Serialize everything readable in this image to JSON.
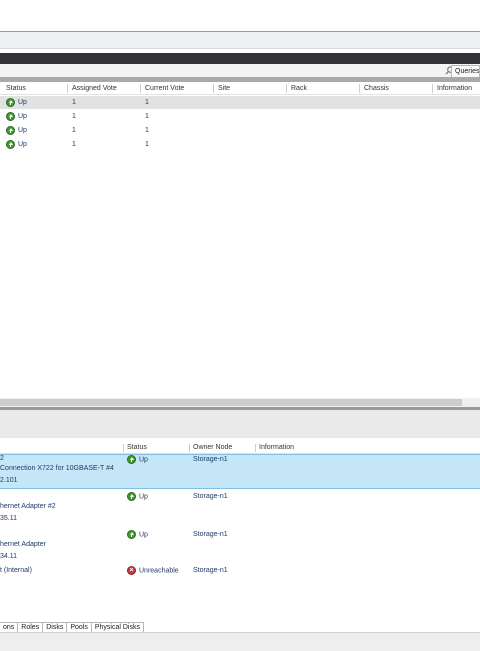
{
  "toolbar": {
    "queries_label": "Queries"
  },
  "nodes_table": {
    "columns": [
      "Status",
      "Assigned Vote",
      "Current Vote",
      "Site",
      "Rack",
      "Chassis",
      "Information"
    ],
    "rows": [
      {
        "status": "Up",
        "assigned_vote": "1",
        "current_vote": "1"
      },
      {
        "status": "Up",
        "assigned_vote": "1",
        "current_vote": "1"
      },
      {
        "status": "Up",
        "assigned_vote": "1",
        "current_vote": "1"
      },
      {
        "status": "Up",
        "assigned_vote": "1",
        "current_vote": "1"
      }
    ]
  },
  "networks_table": {
    "columns": [
      "Status",
      "Owner Node",
      "Information"
    ],
    "rows": [
      {
        "name_lines": [
          "2",
          "Connection X722 for 10GBASE-T #4",
          "2.101"
        ],
        "status": "Up",
        "owner": "Storage-n1",
        "selected": true
      },
      {
        "name_lines": [
          "hernet Adapter #2",
          "35.11"
        ],
        "status": "Up",
        "owner": "Storage-n1"
      },
      {
        "name_lines": [
          "hernet Adapter",
          "34.11"
        ],
        "status": "Up",
        "owner": "Storage-n1"
      },
      {
        "name_lines": [
          "t (Internal)"
        ],
        "status": "Unreachable",
        "owner": "Storage-n1"
      }
    ]
  },
  "bottom_tabs": [
    "ons",
    "Roles",
    "Disks",
    "Pools",
    "Physical Disks"
  ],
  "colors": {
    "selection": "#c5e6f7",
    "status_up": "#3f9b2b",
    "status_unreachable": "#c83a3a"
  }
}
